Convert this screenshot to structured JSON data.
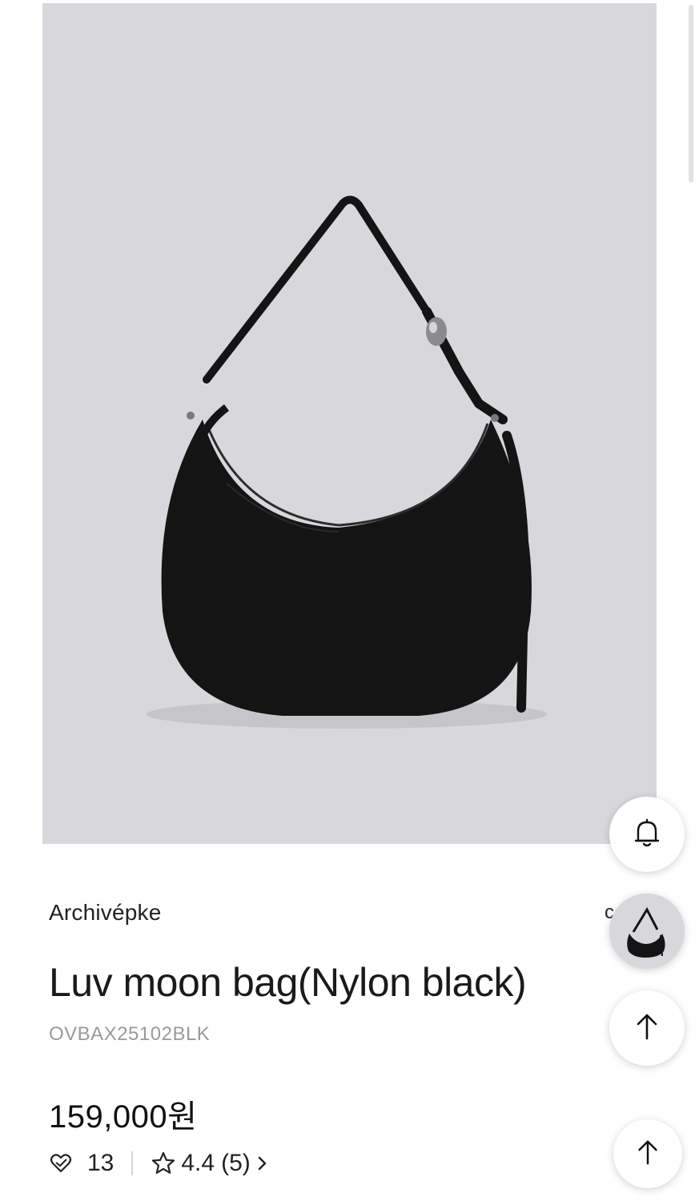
{
  "product": {
    "brand": "Archivépke",
    "name": "Luv moon bag(Nylon black)",
    "sku": "OVBAX25102BLK",
    "price": "159,000원",
    "likes": "13",
    "rating": "4.4",
    "reviews": "(5)"
  },
  "overlap_text": "c",
  "icons": {
    "bell": "bell-icon",
    "thumbnail": "product-thumbnail",
    "scroll_top": "arrow-up-icon",
    "heart": "heart-icon",
    "star": "star-icon",
    "chevron": "chevron-right-icon"
  },
  "colors": {
    "image_background": "#d8d8dc",
    "bag": "#141414",
    "text": "#1a1a1a",
    "muted": "#9a9a9a"
  }
}
